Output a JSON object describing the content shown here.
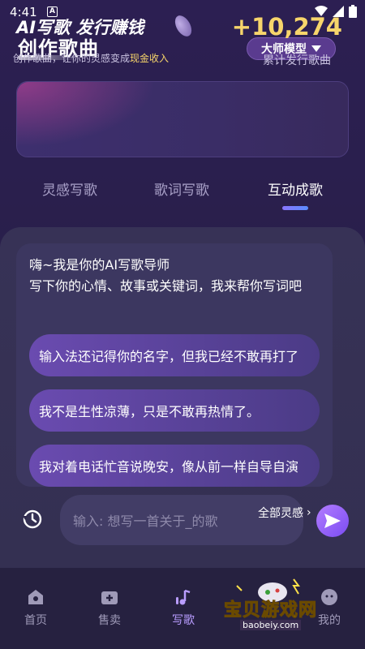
{
  "status_bar": {
    "time": "4:41",
    "notification_letter": "A"
  },
  "header": {
    "title": "创作歌曲",
    "model_select": "大师模型"
  },
  "promo": {
    "title": "AI写歌 发行赚钱",
    "subtitle_prefix": "创作歌曲，让你的灵感变成",
    "subtitle_highlight": "现金收入",
    "count": "+10,274",
    "count_label": "累计发行歌曲"
  },
  "tabs": [
    {
      "label": "灵感写歌",
      "active": false
    },
    {
      "label": "歌词写歌",
      "active": false
    },
    {
      "label": "互动成歌",
      "active": true
    }
  ],
  "chat": {
    "intro_line1": "嗨~我是你的AI写歌导师",
    "intro_line2": "写下你的心情、故事或关键词，我来帮你写词吧",
    "suggestions": [
      "输入法还记得你的名字，但我已经不敢再打了",
      "我不是生性凉薄，只是不敢再热情了。",
      "我对着电话忙音说晚安，像从前一样自导自演"
    ]
  },
  "input": {
    "placeholder": "输入: 想写一首关于_的歌",
    "all_inspiration": "全部灵感"
  },
  "bottom_nav": [
    {
      "label": "首页",
      "icon": "home-icon"
    },
    {
      "label": "售卖",
      "icon": "shop-icon"
    },
    {
      "label": "写歌",
      "icon": "music-note-icon",
      "active": true
    },
    {
      "label": "我的",
      "icon": "profile-icon"
    }
  ],
  "watermark": {
    "text": "宝贝游戏网",
    "url": "baobeiy.com"
  },
  "colors": {
    "accent_gold": "#f7d56b",
    "accent_purple": "#b99dff",
    "tab_indicator": "#7a82ff"
  }
}
